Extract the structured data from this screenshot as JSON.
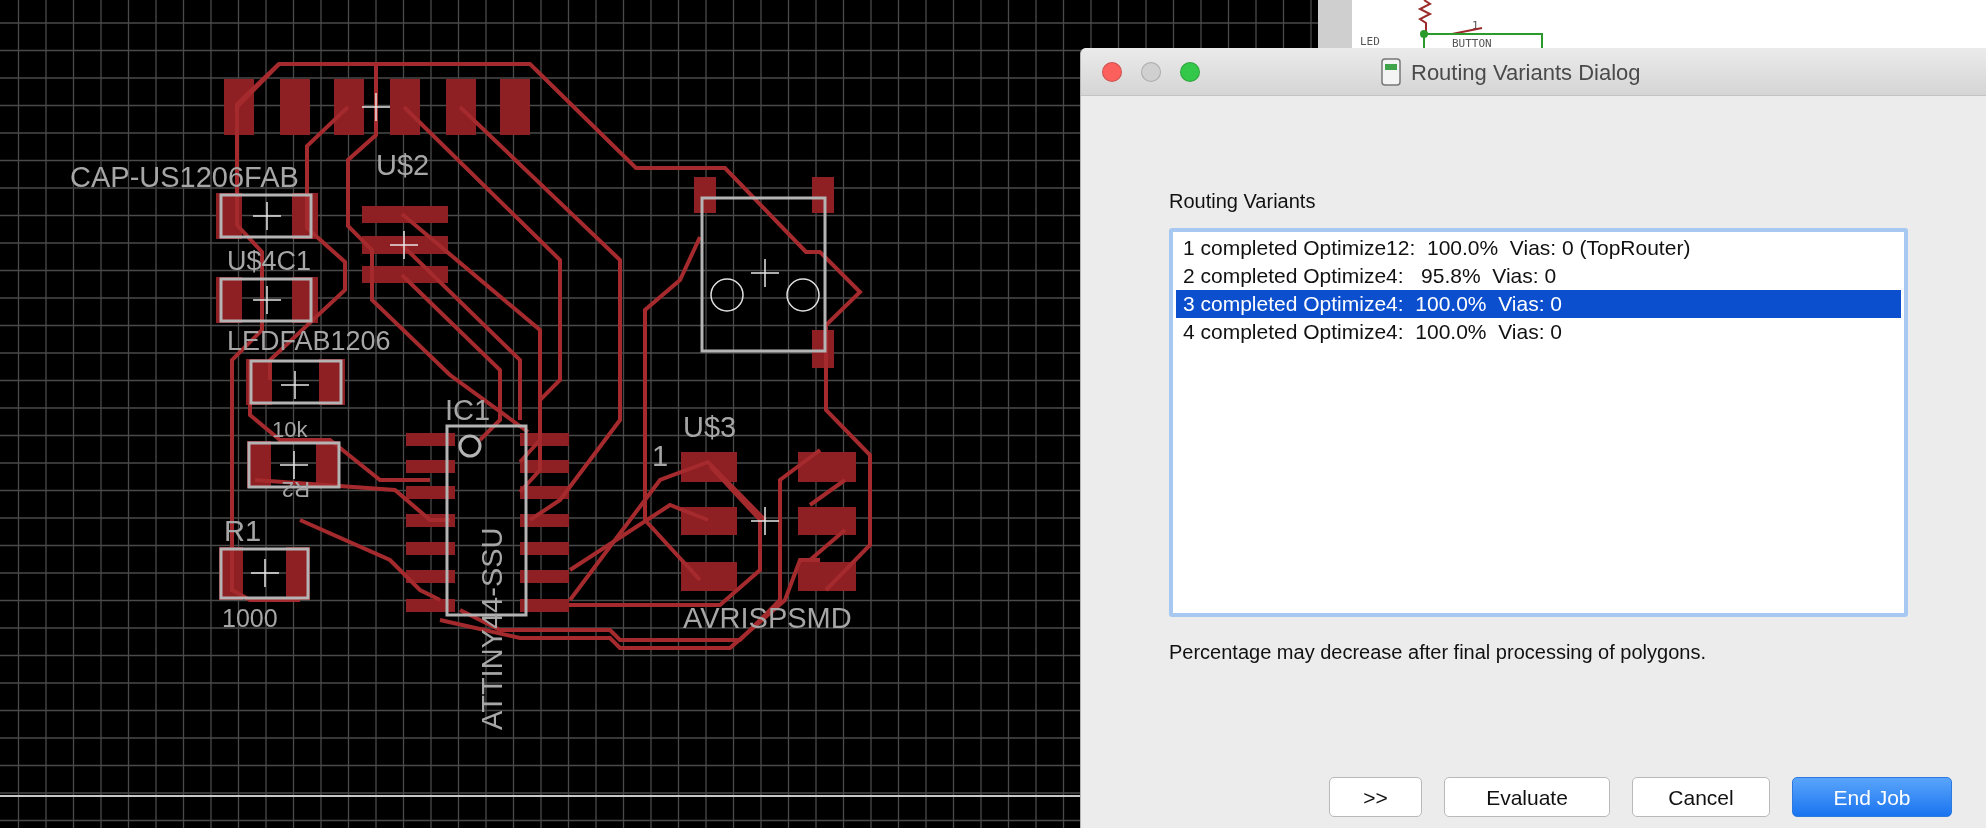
{
  "board": {
    "labels": [
      "CAP-US1206FAB",
      "U$2",
      "U$4C1",
      "LEDFAB1206",
      "10k",
      "R2",
      "R1",
      "1000",
      "IC1",
      "ATTINY44-SSU",
      "U$3",
      "1",
      "AVRISPSMD"
    ]
  },
  "background_window": {
    "labels": [
      "LED",
      "BUTTON",
      "1"
    ]
  },
  "dialog": {
    "title": "Routing Variants Dialog",
    "window_controls": [
      {
        "kind": "close",
        "disabled": false
      },
      {
        "kind": "minimize",
        "disabled": true
      },
      {
        "kind": "zoom",
        "disabled": false
      }
    ],
    "list_label": "Routing Variants",
    "variants": [
      {
        "text": "1 completed Optimize12:  100.0%  Vias: 0 (TopRouter)",
        "selected": false
      },
      {
        "text": "2 completed Optimize4:   95.8%  Vias: 0",
        "selected": false
      },
      {
        "text": "3 completed Optimize4:  100.0%  Vias: 0",
        "selected": true
      },
      {
        "text": "4 completed Optimize4:  100.0%  Vias: 0",
        "selected": false
      }
    ],
    "note": "Percentage may decrease after final processing of polygons.",
    "buttons": [
      {
        "label": ">>",
        "kind": "default"
      },
      {
        "label": "Evaluate",
        "kind": "default"
      },
      {
        "label": "Cancel",
        "kind": "default"
      },
      {
        "label": "End Job",
        "kind": "primary"
      }
    ]
  }
}
